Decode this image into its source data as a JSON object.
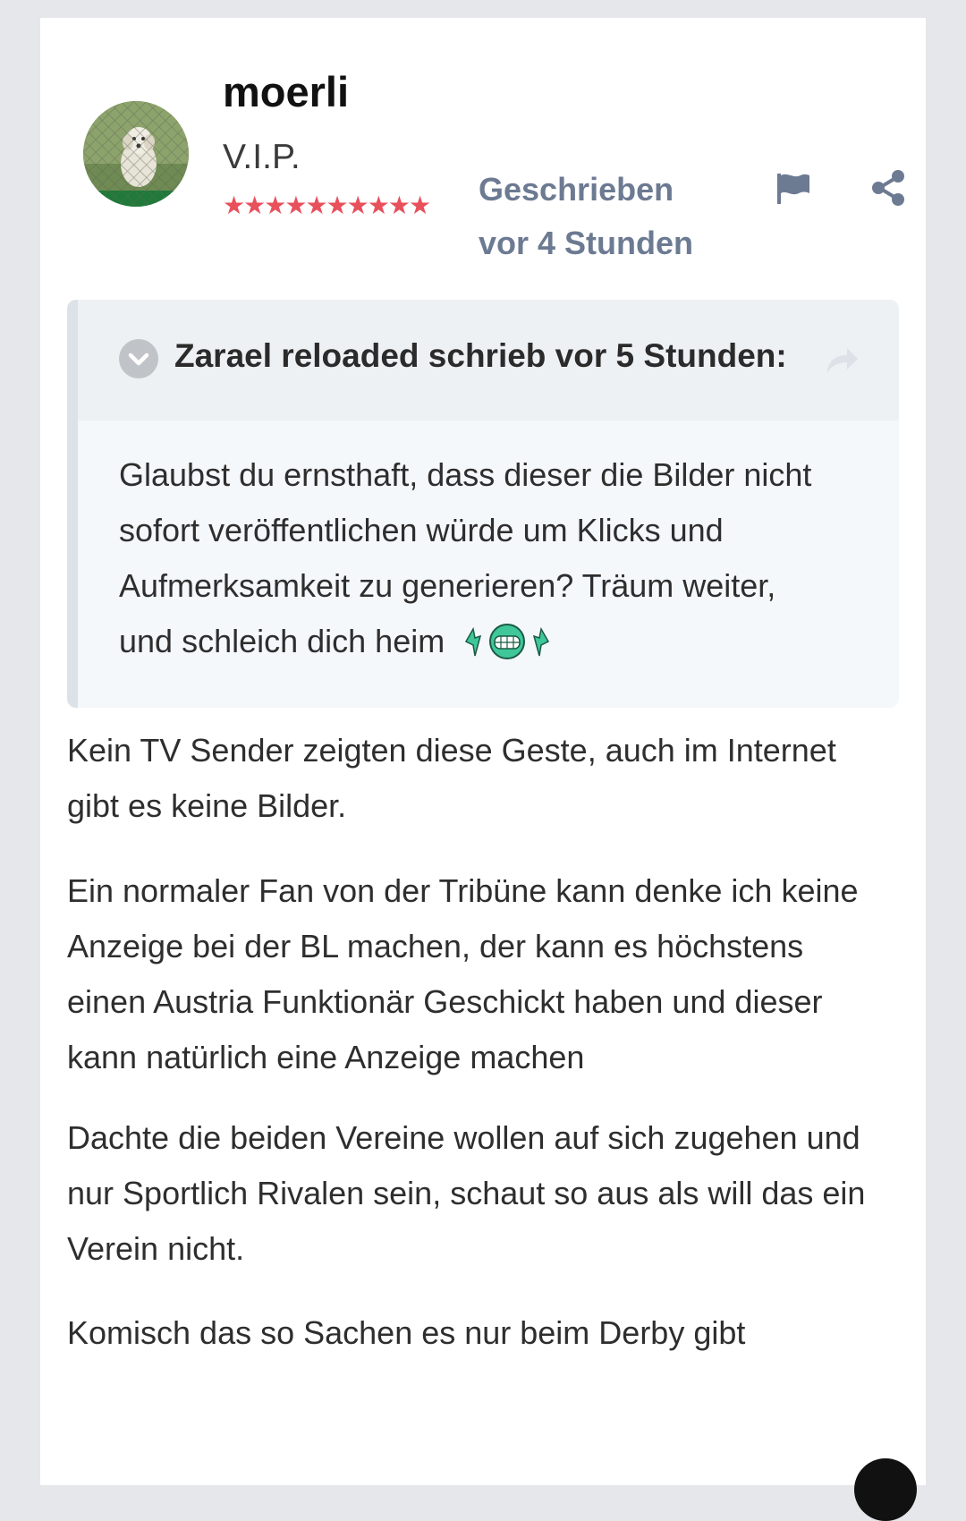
{
  "post": {
    "author": {
      "name": "moerli",
      "rank": "V.I.P.",
      "stars": [
        "★",
        "★",
        "★",
        "★",
        "★",
        "★",
        "★",
        "★",
        "★",
        "★"
      ],
      "avatar_icon": "avatar-dog-photo"
    },
    "date_line1": "Geschrieben",
    "date_line2": "vor 4 Stunden",
    "actions": {
      "report_icon": "flag-icon",
      "share_icon": "share-icon"
    },
    "quote": {
      "header": "Zarael reloaded schrieb vor 5 Stunden:",
      "text": "Glaubst du ernsthaft, dass dieser die Bilder nicht sofort veröffentlichen würde um Klicks und Aufmerksamkeit zu generieren? Träum weiter, und schleich dich heim",
      "emoji_icon": "grinning-dancing-emoji-icon"
    },
    "paragraphs": [
      "Kein TV Sender zeigten diese Geste, auch im Internet gibt es keine Bilder.",
      "Ein normaler Fan von der Tribüne kann denke ich keine Anzeige bei der BL machen, der kann es höchstens einen Austria Funktionär Geschickt haben und dieser kann natürlich eine Anzeige machen",
      "Dachte die beiden Vereine wollen auf sich zugehen und nur Sportlich Rivalen sein, schaut so aus als will das ein Verein nicht.",
      "Komisch das so Sachen es nur beim Derby gibt"
    ]
  },
  "colors": {
    "accent": "#6c7a92",
    "stars": "#e8505b",
    "quote_bg": "#f5f8fb",
    "quote_head_bg": "#eef1f4"
  }
}
